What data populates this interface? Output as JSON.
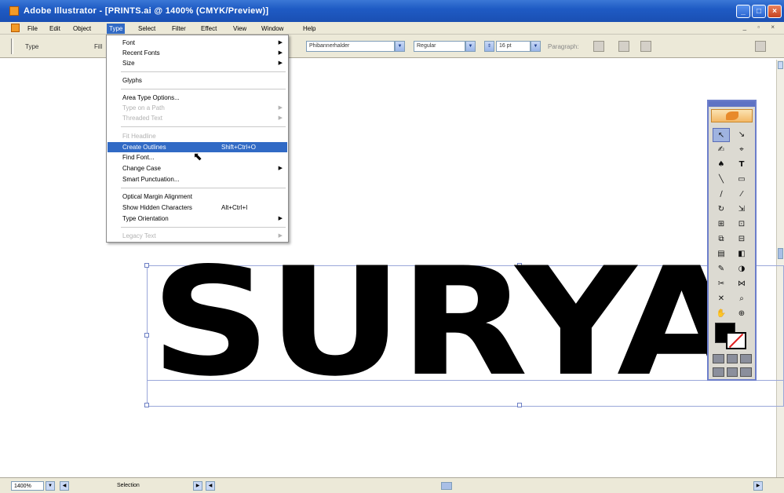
{
  "window": {
    "title": "Adobe Illustrator - [PRINTS.ai @ 1400% (CMYK/Preview)]",
    "controls": {
      "minimize": "_",
      "maximize": "□",
      "close": "×"
    }
  },
  "menubar": {
    "items": [
      "File",
      "Edit",
      "Object",
      "Type",
      "Select",
      "Filter",
      "Effect",
      "View",
      "Window",
      "Help"
    ],
    "active": "Type",
    "mdi_controls": "_ ▫ ×"
  },
  "controlbar": {
    "left_label": "Type",
    "char_label": "Fill",
    "font_name": "Phibannerhalder",
    "font_style": "Regular",
    "font_size": "16 pt",
    "paragraph_label": "Paragraph:"
  },
  "type_menu": {
    "items": [
      {
        "label": "Font",
        "submenu": true,
        "disabled": false
      },
      {
        "label": "Recent Fonts",
        "submenu": true,
        "disabled": false
      },
      {
        "label": "Size",
        "submenu": true,
        "disabled": false
      },
      {
        "label": "Glyphs",
        "submenu": false,
        "disabled": false
      },
      {
        "label": "Area Type Options...",
        "submenu": false,
        "disabled": false
      },
      {
        "label": "Type on a Path",
        "submenu": true,
        "disabled": true
      },
      {
        "label": "Threaded Text",
        "submenu": true,
        "disabled": true
      },
      {
        "label": "Fit Headline",
        "submenu": false,
        "disabled": true
      },
      {
        "label": "Create Outlines",
        "shortcut": "Shift+Ctrl+O",
        "highlight": true,
        "disabled": false
      },
      {
        "label": "Find Font...",
        "submenu": false,
        "disabled": false
      },
      {
        "label": "Change Case",
        "submenu": true,
        "disabled": false
      },
      {
        "label": "Smart Punctuation...",
        "submenu": false,
        "disabled": false
      },
      {
        "label": "Optical Margin Alignment",
        "submenu": false,
        "disabled": false
      },
      {
        "label": "Show Hidden Characters",
        "shortcut": "Alt+Ctrl+I",
        "disabled": false
      },
      {
        "label": "Type Orientation",
        "submenu": true,
        "disabled": false
      },
      {
        "label": "Legacy Text",
        "submenu": true,
        "disabled": true
      }
    ]
  },
  "canvas": {
    "text": "SURYA"
  },
  "tools_panel": {
    "tools": [
      "↖",
      "↘",
      "✍",
      "⌖",
      "♠",
      "T",
      "╲",
      "▭",
      "∕",
      "⁄",
      "↻",
      "⇲",
      "⊞",
      "⊡",
      "⧉",
      "⊟",
      "▤",
      "◧",
      "✎",
      "◑",
      "✂",
      "⋈",
      "✕",
      "⌕",
      "⊕",
      "✋"
    ]
  },
  "statusbar": {
    "zoom": "1400%",
    "mode": "Selection"
  },
  "colors": {
    "titlebar": "#1f5bc4",
    "menu_highlight": "#316ac5",
    "panel_border": "#6c7ecb"
  }
}
